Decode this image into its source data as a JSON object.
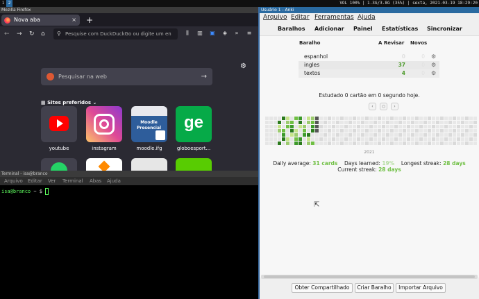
{
  "topbar": {
    "workspaces": [
      "1",
      "2"
    ],
    "status": "VOL 100% | 1.3G/3.8G (35%) | sexta, 2021-03-19 18:29:20"
  },
  "firefox": {
    "window_title": "Mozilla Firefox",
    "tab_title": "Nova aba",
    "tab_close": "×",
    "new_tab": "+",
    "url_placeholder": "Pesquise com DuckDuckGo ou digite um en",
    "search_placeholder": "Pesquisar na web",
    "top_sites_label": "Sites preferidos",
    "sites": [
      {
        "label": "youtube",
        "color": "#ff0000"
      },
      {
        "label": "instagram",
        "color": "#d6249f"
      },
      {
        "label": "moodle.ifg",
        "color": "#1b4f8a"
      },
      {
        "label": "globoesport...",
        "color": "#06aa48"
      }
    ],
    "ge_text": "ge"
  },
  "terminal": {
    "window_title": "Terminal - isa@branco",
    "menu": [
      "Arquivo",
      "Editar",
      "Ver",
      "Terminal",
      "Abas",
      "Ajuda"
    ],
    "prompt_user": "isa@branco",
    "prompt_rest": " ~ $ "
  },
  "anki": {
    "window_title": "Usuário 1 - Anki",
    "menu": [
      "Arquivo",
      "Editar",
      "Ferramentas",
      "Ajuda"
    ],
    "toolbar": [
      "Baralhos",
      "Adicionar",
      "Painel",
      "Estatísticas",
      "Sincronizar"
    ],
    "deck_headers": {
      "deck": "Baralho",
      "due": "A Revisar",
      "new": "Novos"
    },
    "decks": [
      {
        "name": "espanhol",
        "due": "0",
        "new": "0"
      },
      {
        "name": "ingles",
        "due": "37",
        "new": "0"
      },
      {
        "name": "textos",
        "due": "4",
        "new": "0"
      }
    ],
    "studied": "Estudado 0 cartão em 0 segundo hoje.",
    "year": "2021",
    "stats": {
      "daily_label": "Daily average:",
      "daily_value": "31 cards",
      "days_label": "Days learned:",
      "days_value": "19%",
      "longest_label": "Longest streak:",
      "longest_value": "28 days",
      "current_label": "Current streak:",
      "current_value": "28 days"
    },
    "bottom_buttons": [
      "Obter Compartilhado",
      "Criar Baralho",
      "Importar Arquivo"
    ],
    "colors": {
      "green": "#6fbf43",
      "blue": "#1f5fbf",
      "title_bar": "#2a6aa0"
    }
  }
}
